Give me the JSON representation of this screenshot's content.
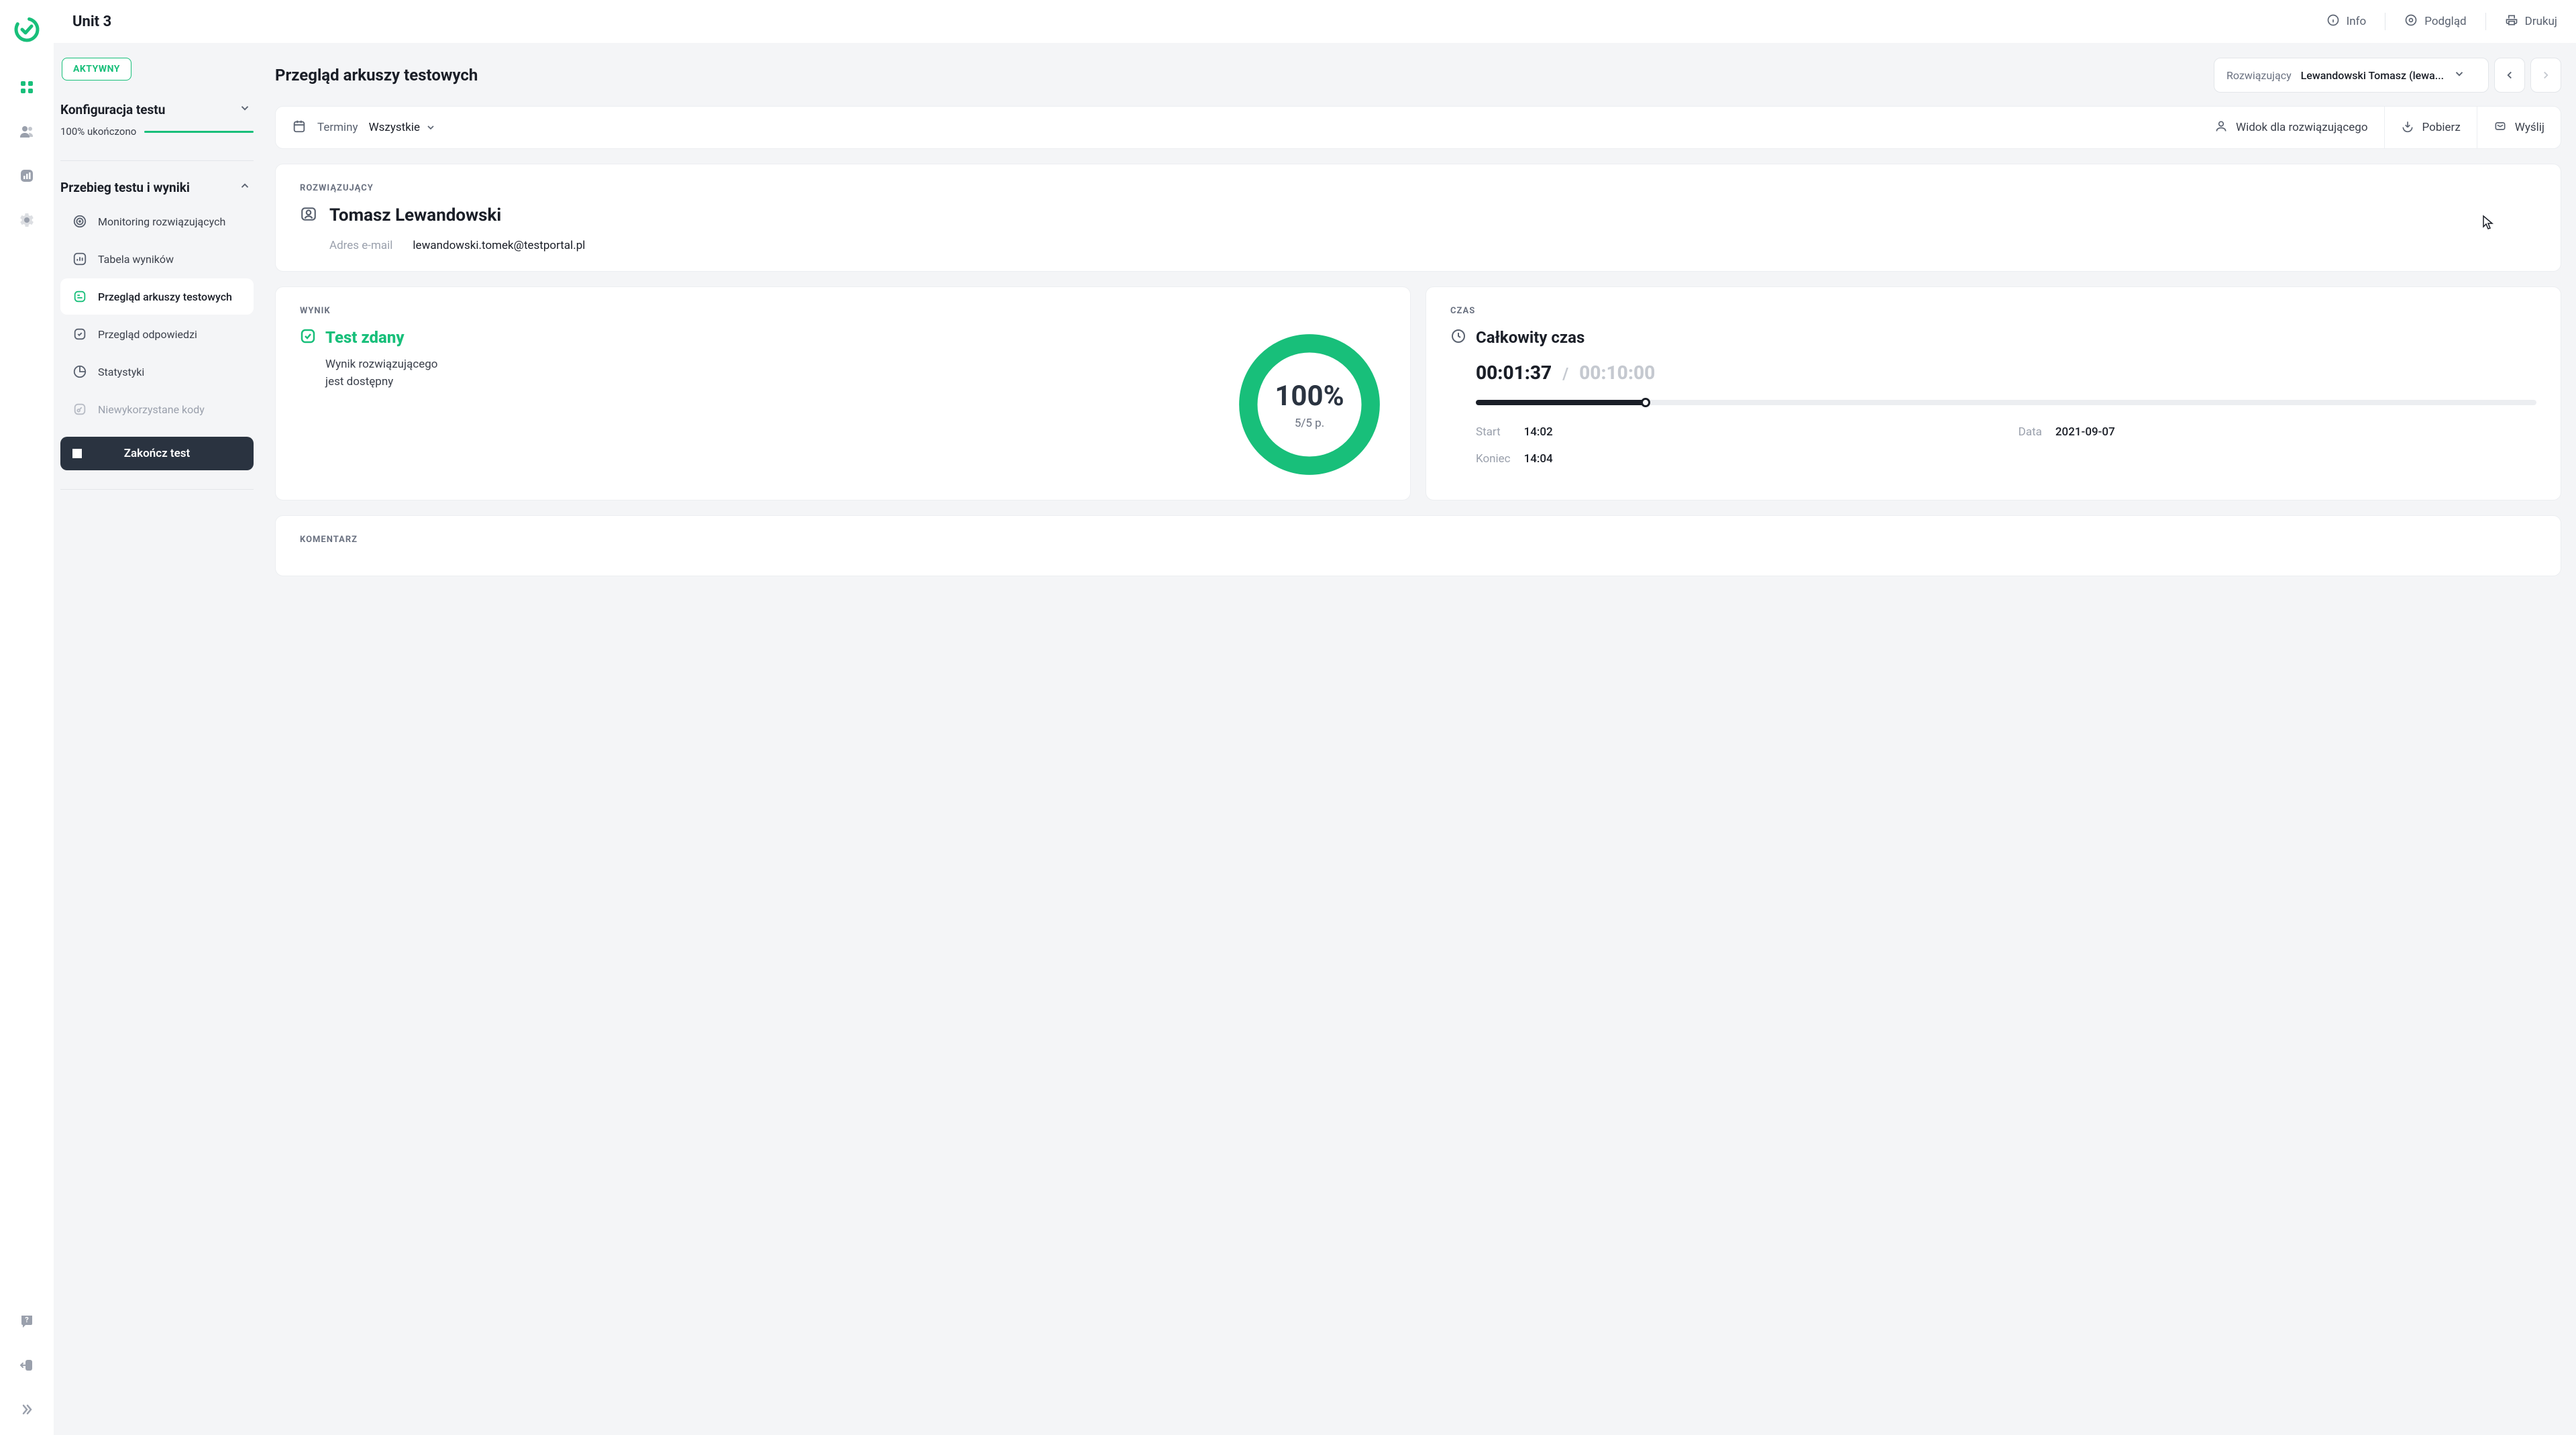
{
  "app": {
    "title": "Unit 3"
  },
  "topbar": {
    "info": "Info",
    "preview": "Podgląd",
    "print": "Drukuj"
  },
  "sidebar": {
    "badge": "AKTYWNY",
    "config_title": "Konfiguracja testu",
    "progress_label": "100% ukończono",
    "progress_percent": 100,
    "results_title": "Przebieg testu i wyniki",
    "items": [
      {
        "label": "Monitoring rozwiązujących"
      },
      {
        "label": "Tabela wyników"
      },
      {
        "label": "Przegląd arkuszy testowych"
      },
      {
        "label": "Przegląd odpowiedzi"
      },
      {
        "label": "Statystyki"
      },
      {
        "label": "Niewykorzystane kody"
      }
    ],
    "end_button": "Zakończ test"
  },
  "page": {
    "title": "Przegląd arkuszy testowych",
    "solver_label": "Rozwiązujący",
    "solver_value": "Lewandowski Tomasz (lewa..."
  },
  "toolbar": {
    "terms_label": "Terminy",
    "terms_value": "Wszystkie",
    "solver_view": "Widok dla rozwiązującego",
    "download": "Pobierz",
    "send": "Wyślij"
  },
  "solver_card": {
    "label": "ROZWIĄZUJĄCY",
    "name": "Tomasz Lewandowski",
    "email_label": "Adres e-mail",
    "email_value": "lewandowski.tomek@testportal.pl"
  },
  "result_card": {
    "label": "WYNIK",
    "title": "Test zdany",
    "subtitle": "Wynik rozwiązującego jest dostępny",
    "percent": "100%",
    "points": "5/5 p."
  },
  "time_card": {
    "label": "CZAS",
    "title": "Całkowity czas",
    "elapsed": "00:01:37",
    "total": "00:10:00",
    "fraction": 16,
    "start_label": "Start",
    "start_value": "14:02",
    "date_label": "Data",
    "date_value": "2021-09-07",
    "end_label": "Koniec",
    "end_value": "14:04"
  },
  "comment_card": {
    "label": "KOMENTARZ"
  }
}
